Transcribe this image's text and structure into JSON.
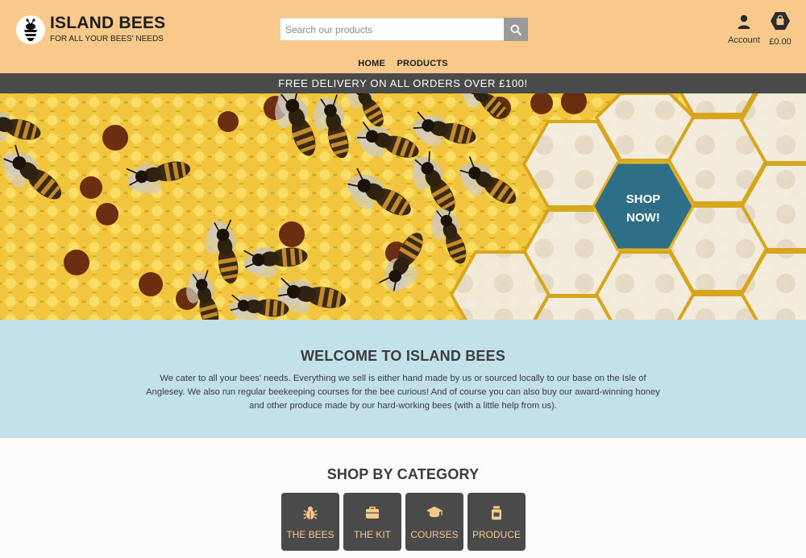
{
  "brand": {
    "name": "ISLAND BEES",
    "tagline": "FOR ALL YOUR BEES' NEEDS"
  },
  "search": {
    "placeholder": "Search our products",
    "value": ""
  },
  "account": {
    "label": "Account"
  },
  "cart": {
    "total": "£0.00"
  },
  "nav": {
    "items": [
      {
        "label": "HOME"
      },
      {
        "label": "PRODUCTS"
      }
    ]
  },
  "banner": {
    "text": "FREE DELIVERY ON ALL ORDERS OVER £100!"
  },
  "hero": {
    "cta_line1": "SHOP",
    "cta_line2": "NOW!"
  },
  "welcome": {
    "title": "WELCOME TO ISLAND BEES",
    "body": "We cater to all your bees' needs. Everything we sell is either hand made by us or sourced locally to our base on the Isle of Anglesey. We also run regular beekeeping courses for the bee curious! And of course you can also buy our award-winning honey and other produce made by our hard-working bees (with a little help from us)."
  },
  "categories": {
    "title": "SHOP BY CATEGORY",
    "items": [
      {
        "label": "THE BEES",
        "icon": "bug-icon"
      },
      {
        "label": "THE KIT",
        "icon": "briefcase-icon"
      },
      {
        "label": "COURSES",
        "icon": "graduation-cap-icon"
      },
      {
        "label": "PRODUCE",
        "icon": "jar-icon"
      }
    ]
  },
  "colors": {
    "header_bg": "#f8c98a",
    "banner_bg": "#4a4a4a",
    "welcome_bg": "#c3e1ea",
    "cta_bg": "#2e6e86",
    "category_bg": "#4a4a4a",
    "category_text": "#f6c98c"
  }
}
